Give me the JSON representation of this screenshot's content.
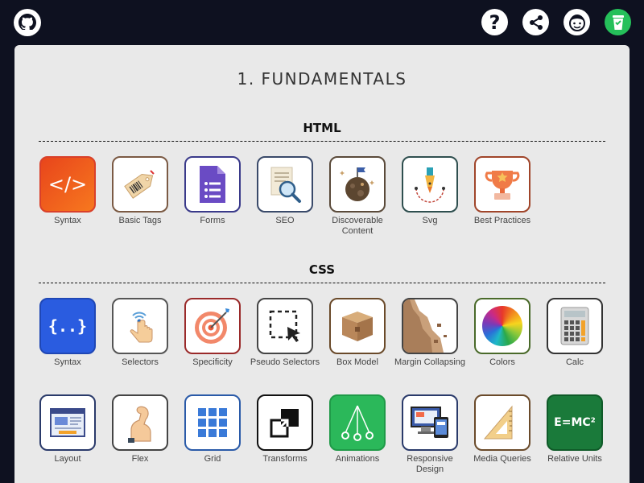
{
  "header": {
    "github": "github-icon",
    "actions": [
      {
        "icon": "help-icon",
        "label": "?"
      },
      {
        "icon": "share-icon"
      },
      {
        "icon": "avatar-icon"
      },
      {
        "icon": "coffee-cup-icon"
      }
    ]
  },
  "page": {
    "title": "1. FUNDAMENTALS"
  },
  "sections": {
    "html": {
      "title": "HTML",
      "items": [
        {
          "label": "Syntax",
          "icon": "code-tag-icon",
          "text": "</>"
        },
        {
          "label": "Basic Tags",
          "icon": "price-tag-icon"
        },
        {
          "label": "Forms",
          "icon": "form-document-icon"
        },
        {
          "label": "SEO",
          "icon": "magnifier-document-icon"
        },
        {
          "label": "Discoverable Content",
          "icon": "planet-flag-icon"
        },
        {
          "label": "Svg",
          "icon": "pen-nib-icon"
        },
        {
          "label": "Best Practices",
          "icon": "trophy-icon"
        }
      ]
    },
    "css": {
      "title": "CSS",
      "items": [
        {
          "label": "Syntax",
          "icon": "curly-braces-icon",
          "text": "{..}"
        },
        {
          "label": "Selectors",
          "icon": "finger-tap-icon"
        },
        {
          "label": "Specificity",
          "icon": "target-icon"
        },
        {
          "label": "Pseudo Selectors",
          "icon": "dashed-selection-icon"
        },
        {
          "label": "Box Model",
          "icon": "cardboard-box-icon"
        },
        {
          "label": "Margin Collapsing",
          "icon": "cliff-icon"
        },
        {
          "label": "Colors",
          "icon": "color-wheel-icon"
        },
        {
          "label": "Calc",
          "icon": "calculator-icon"
        },
        {
          "label": "Layout",
          "icon": "web-layout-icon"
        },
        {
          "label": "Flex",
          "icon": "flexed-arm-icon"
        },
        {
          "label": "Grid",
          "icon": "grid-icon"
        },
        {
          "label": "Transforms",
          "icon": "resize-arrow-icon"
        },
        {
          "label": "Animations",
          "icon": "pendulum-icon"
        },
        {
          "label": "Responsive Design",
          "icon": "devices-icon"
        },
        {
          "label": "Media Queries",
          "icon": "set-square-icon"
        },
        {
          "label": "Relative Units",
          "icon": "emc2-icon",
          "text": "E=MC²"
        }
      ]
    }
  },
  "colors": {
    "background": "#0e1120",
    "panel": "#e9e9e9",
    "accent_green": "#25c05a"
  }
}
